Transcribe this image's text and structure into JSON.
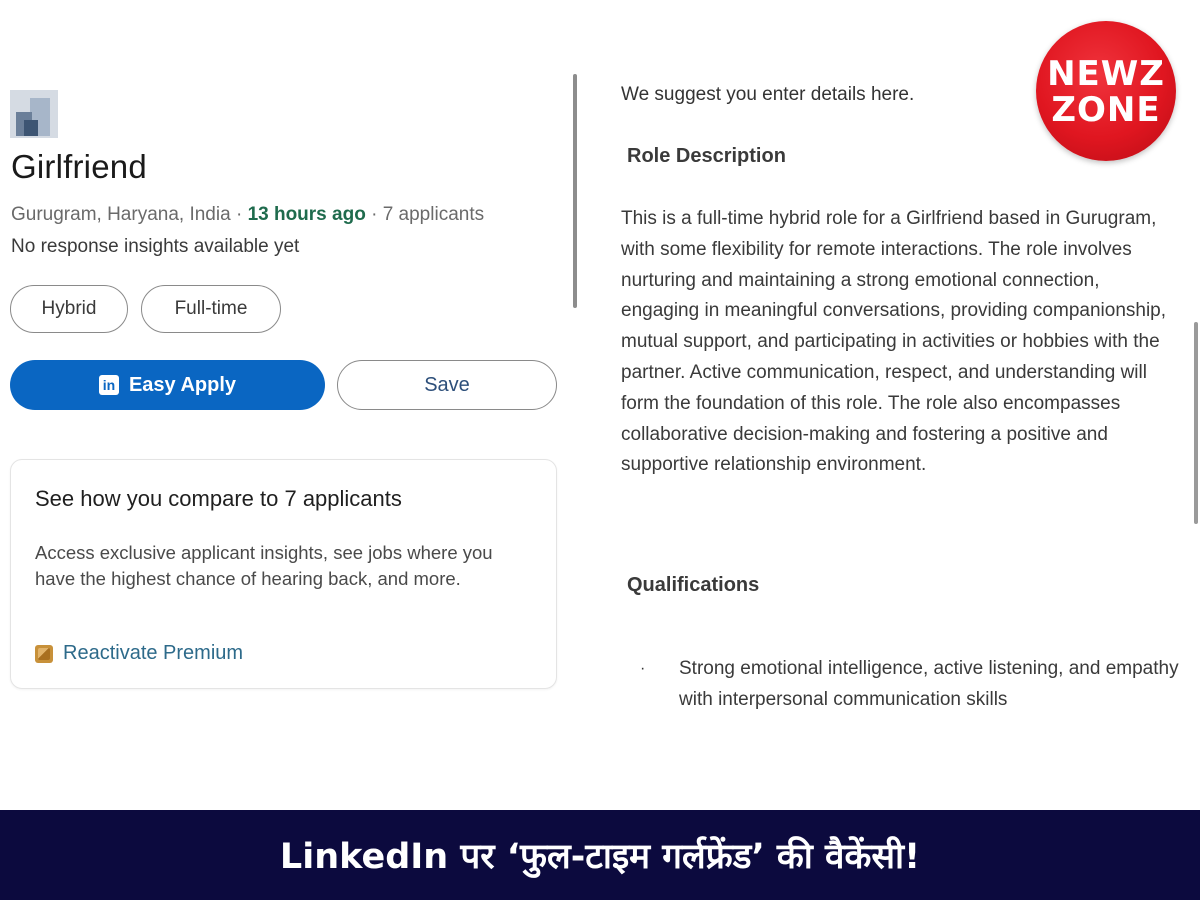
{
  "job": {
    "title": "Girlfriend",
    "location": "Gurugram, Haryana, India",
    "separator": " · ",
    "posted": "13 hours ago",
    "applicants": "7 applicants",
    "insights": "No response insights available yet",
    "tags": [
      "Hybrid",
      "Full-time"
    ],
    "apply_label": "Easy Apply",
    "apply_icon_text": "in",
    "save_label": "Save"
  },
  "compare_card": {
    "title": "See how you compare to 7 applicants",
    "body": "Access exclusive applicant insights, see jobs where you have the highest chance of hearing back, and more.",
    "premium_link": "Reactivate Premium"
  },
  "details": {
    "suggest": "We suggest you enter details here.",
    "role_heading": "Role Description",
    "role_description": "This is a full-time hybrid role for a Girlfriend based in Gurugram, with some flexibility for remote interactions. The role involves nurturing and maintaining a strong emotional connection, engaging in meaningful conversations, providing companionship, mutual support, and participating in activities or hobbies with the partner. Active communication, respect, and understanding will form the foundation of this role. The role also encompasses collaborative decision-making and fostering a positive and supportive relationship environment.",
    "qualifications_heading": "Qualifications",
    "bullet_char": "·",
    "qualifications": [
      "Strong emotional intelligence, active listening, and empathy with interpersonal communication skills"
    ]
  },
  "logo": {
    "line1": "NEWZ",
    "line2": "ZONE"
  },
  "banner": {
    "headline": "LinkedIn पर ‘फुल-टाइम गर्लफ्रेंड’ की वैकेंसी!"
  },
  "colors": {
    "linkedin_blue": "#0a66c2",
    "banner_bg": "#0c0a3e",
    "logo_red": "#e01620",
    "posted_green": "#1f6b4d"
  },
  "icons": {
    "company": "company-logo-icon",
    "linkedin": "linkedin-icon",
    "premium": "premium-icon"
  }
}
